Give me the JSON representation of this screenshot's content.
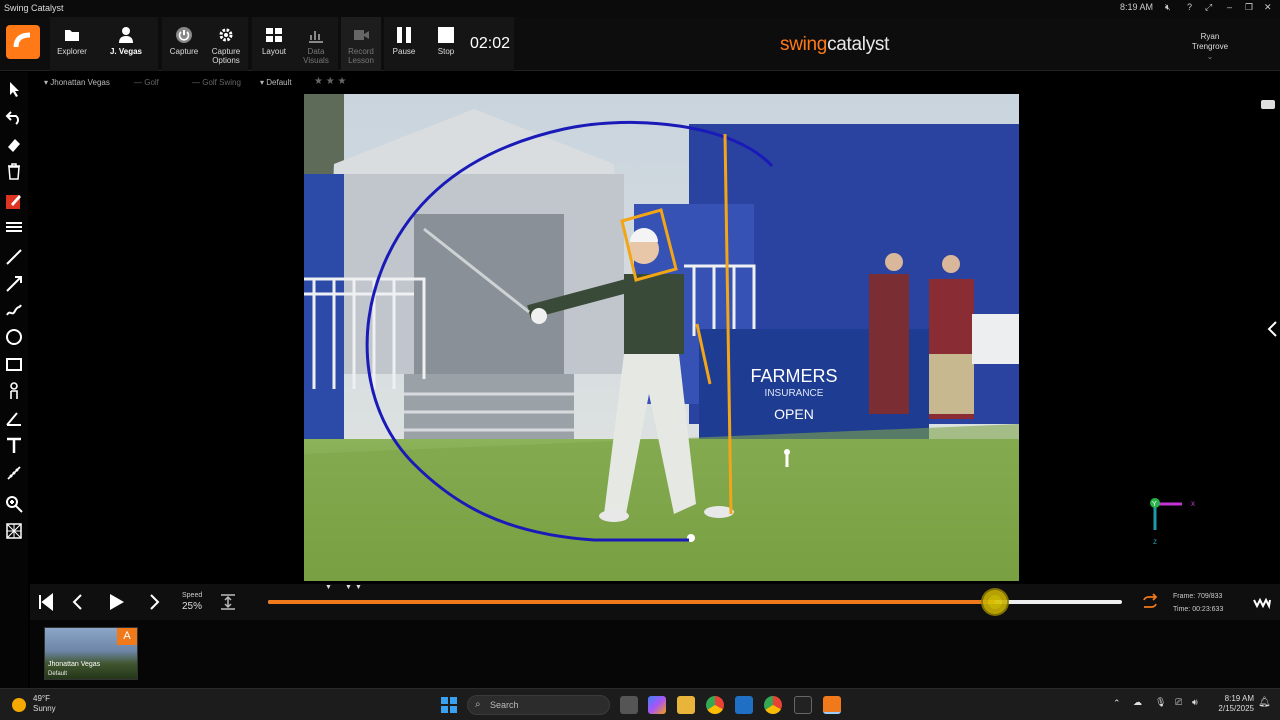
{
  "app": {
    "title": "Swing Catalyst",
    "clock_title": "8:19 AM"
  },
  "toolbar": {
    "buttons": [
      {
        "label": "Explorer"
      },
      {
        "label": "J. Vegas"
      },
      {
        "label": "Capture"
      },
      {
        "label": "Capture Options"
      },
      {
        "label": "Layout"
      },
      {
        "label": "Data Visuals"
      },
      {
        "label": "Record Lesson"
      },
      {
        "label": "Pause"
      },
      {
        "label": "Stop"
      }
    ],
    "timer": "02:02",
    "brand_accent": "swing",
    "brand_rest": "catalyst",
    "user_first": "Ryan",
    "user_last": "Trengrove"
  },
  "breadcrumb": {
    "player": "Jhonattan Vegas",
    "sport": "Golf",
    "category": "Golf Swing",
    "view": "Default",
    "rating_stars": 3,
    "rating_value": 0
  },
  "video": {
    "banner_line1": "FARMERS",
    "banner_line2": "INSURANCE",
    "banner_line3": "OPEN",
    "axis_x": "x",
    "axis_y": "Y",
    "axis_z": "z"
  },
  "playback": {
    "speed_label": "Speed",
    "speed_value": "25%",
    "progress": 0.851,
    "frame_label": "Frame:",
    "frame_value": "709/833",
    "time_label": "Time:",
    "time_value": "00:23:633"
  },
  "thumbnail": {
    "badge": "A",
    "name": "Jhonattan Vegas",
    "view": "Default"
  },
  "taskbar": {
    "temp": "49°F",
    "condition": "Sunny",
    "search_placeholder": "Search",
    "time": "8:19 AM",
    "date": "2/15/2025"
  },
  "colors": {
    "accent": "#f07a1b",
    "drawing_blue": "#1a1ab8",
    "drawing_orange": "#f2a516"
  }
}
